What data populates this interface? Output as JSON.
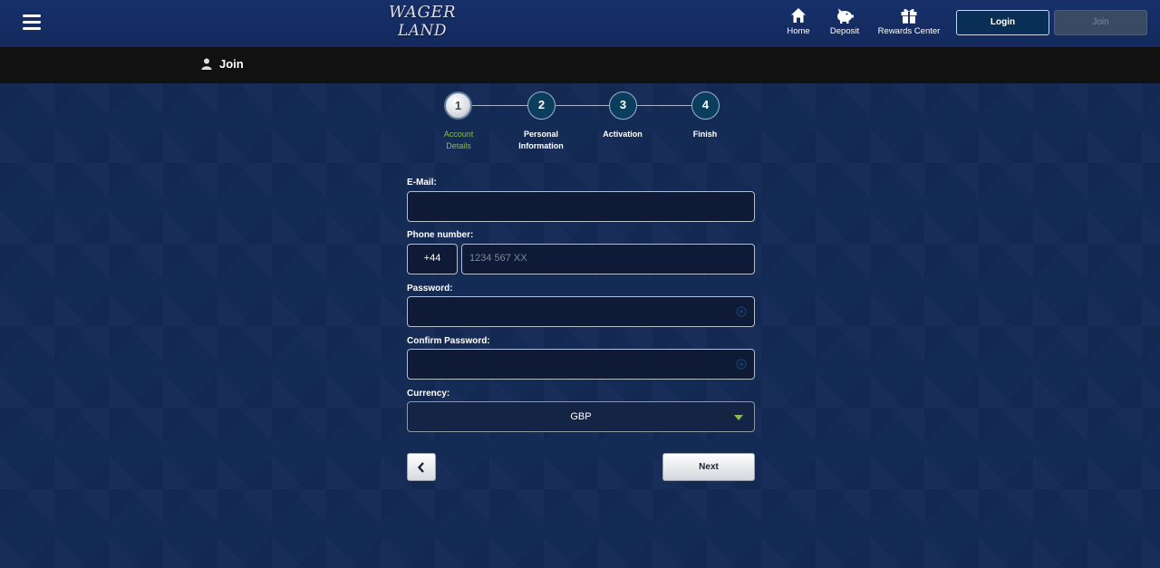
{
  "header": {
    "logo_line1": "WAGER",
    "logo_line2": "LAND",
    "nav": [
      {
        "label": "Home",
        "icon": "home-icon"
      },
      {
        "label": "Deposit",
        "icon": "piggy-bank-icon"
      },
      {
        "label": "Rewards Center",
        "icon": "gift-icon"
      }
    ],
    "login_label": "Login",
    "join_label": "Join"
  },
  "subheader": {
    "title": "Join"
  },
  "steps": [
    {
      "number": "1",
      "label": "Account Details",
      "active": true
    },
    {
      "number": "2",
      "label": "Personal Information",
      "active": false
    },
    {
      "number": "3",
      "label": "Activation",
      "active": false
    },
    {
      "number": "4",
      "label": "Finish",
      "active": false
    }
  ],
  "form": {
    "email_label": "E-Mail:",
    "email_value": "",
    "phone_label": "Phone number:",
    "phone_prefix": "+44",
    "phone_placeholder": "1234 567 XX",
    "password_label": "Password:",
    "confirm_password_label": "Confirm Password:",
    "currency_label": "Currency:",
    "currency_value": "GBP",
    "next_label": "Next"
  },
  "colors": {
    "accent_green": "#8bbd4c",
    "background": "#142b55",
    "login_bg": "#0a2f57"
  }
}
